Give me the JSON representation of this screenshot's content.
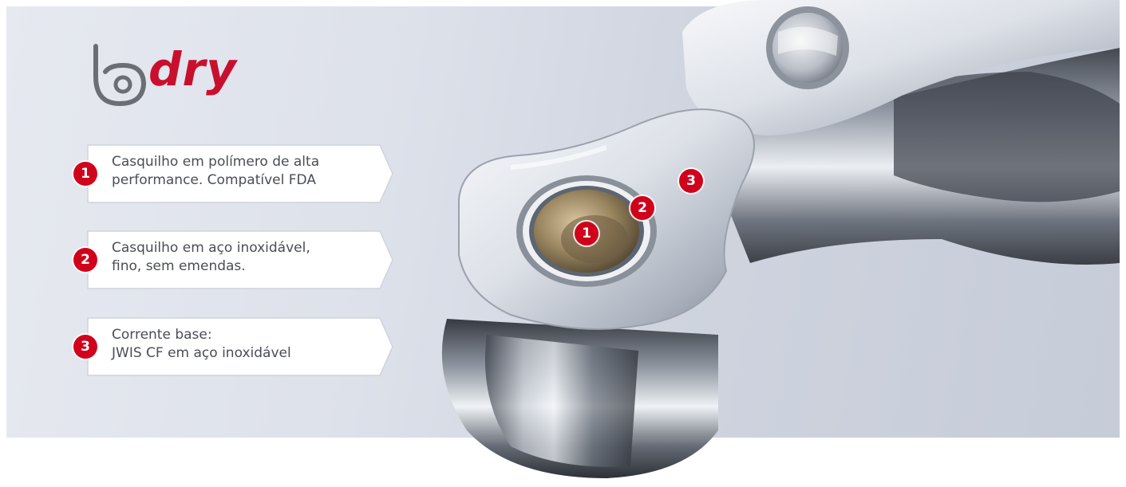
{
  "brand": {
    "word": "dry",
    "color": "#c8102e",
    "mark_icon": "igus-b-logo-icon"
  },
  "callouts": [
    {
      "number": "1",
      "lines": [
        "Casquilho em polímero de alta",
        "performance. Compatível FDA"
      ]
    },
    {
      "number": "2",
      "lines": [
        "Casquilho em aço inoxidável,",
        "fino, sem emendas."
      ]
    },
    {
      "number": "3",
      "lines": [
        "Corrente base:",
        "JWIS CF em aço inoxidável"
      ]
    }
  ],
  "markers": {
    "bushing": "1",
    "sleeve": "2",
    "plate": "3"
  },
  "colors": {
    "accent_red": "#d0021b",
    "text_gray": "#4a4d55"
  }
}
